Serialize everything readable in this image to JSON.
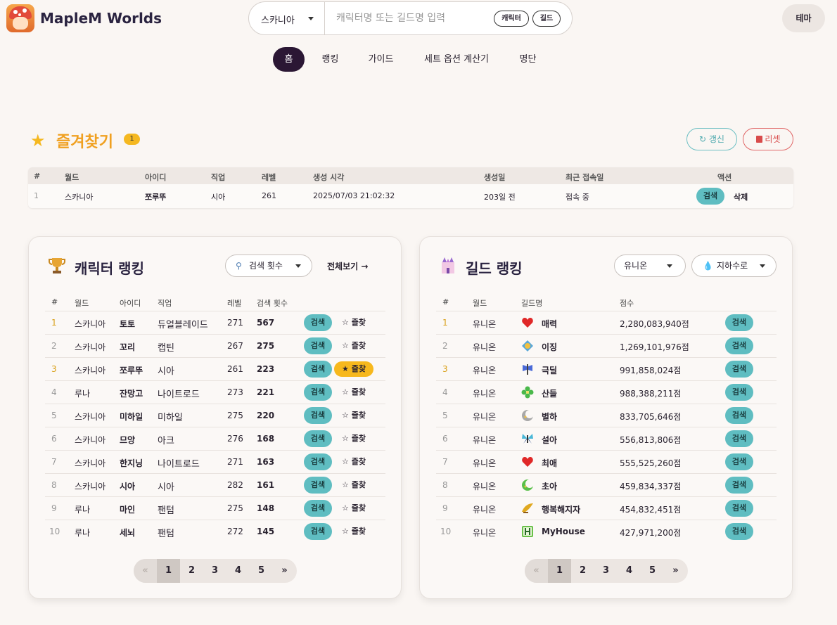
{
  "header": {
    "brand": "MapleM Worlds",
    "search": {
      "world": "스카니아",
      "placeholder": "캐릭터명 또는 길드명 입력",
      "chip_character": "캐릭터",
      "chip_guild": "길드"
    },
    "theme_label": "테마"
  },
  "nav": [
    "홈",
    "랭킹",
    "가이드",
    "세트 옵션 계산기",
    "명단"
  ],
  "favorites": {
    "title": "즐겨찾기",
    "count": "1",
    "refresh_label": "갱신",
    "reset_label": "리셋",
    "columns": [
      "#",
      "월드",
      "아이디",
      "직업",
      "레벨",
      "생성 시각",
      "생성일",
      "최근 접속일",
      "액션"
    ],
    "rows": [
      {
        "rank": "1",
        "world": "스카니아",
        "id": "쪼루뚜",
        "job": "시아",
        "level": "261",
        "created_at": "2025/07/03 21:02:32",
        "created_ago": "203일 전",
        "last_login": "접속 중",
        "search": "검색",
        "delete": "삭제"
      }
    ]
  },
  "char_ranking": {
    "title": "캐릭터 랭킹",
    "sort_label": "검색 횟수",
    "viewall": "전체보기 →",
    "columns": [
      "#",
      "월드",
      "아이디",
      "직업",
      "레벨",
      "검색 횟수"
    ],
    "search_label": "검색",
    "rows": [
      {
        "rank": "1",
        "world": "스카니아",
        "id": "토토",
        "job": "듀얼블레이드",
        "level": "271",
        "count": "567",
        "fav": "☆ 즐찾"
      },
      {
        "rank": "2",
        "world": "스카니아",
        "id": "꼬리",
        "job": "캡틴",
        "level": "267",
        "count": "275",
        "fav": "☆ 즐찾"
      },
      {
        "rank": "3",
        "world": "스카니아",
        "id": "쪼루뚜",
        "job": "시아",
        "level": "261",
        "count": "223",
        "fav": "★ 즐찾"
      },
      {
        "rank": "4",
        "world": "루나",
        "id": "잔망고",
        "job": "나이트로드",
        "level": "273",
        "count": "221",
        "fav": "☆ 즐찾"
      },
      {
        "rank": "5",
        "world": "스카니아",
        "id": "미하일",
        "job": "미하일",
        "level": "275",
        "count": "220",
        "fav": "☆ 즐찾"
      },
      {
        "rank": "6",
        "world": "스카니아",
        "id": "므앙",
        "job": "아크",
        "level": "276",
        "count": "168",
        "fav": "☆ 즐찾"
      },
      {
        "rank": "7",
        "world": "스카니아",
        "id": "한지닝",
        "job": "나이트로드",
        "level": "271",
        "count": "163",
        "fav": "☆ 즐찾"
      },
      {
        "rank": "8",
        "world": "스카니아",
        "id": "시아",
        "job": "시아",
        "level": "282",
        "count": "161",
        "fav": "☆ 즐찾"
      },
      {
        "rank": "9",
        "world": "루나",
        "id": "마인",
        "job": "팬텀",
        "level": "275",
        "count": "148",
        "fav": "☆ 즐찾"
      },
      {
        "rank": "10",
        "world": "루나",
        "id": "세뇌",
        "job": "팬텀",
        "level": "272",
        "count": "145",
        "fav": "☆ 즐찾"
      }
    ],
    "pager": [
      "«",
      "1",
      "2",
      "3",
      "4",
      "5",
      "»"
    ]
  },
  "guild_ranking": {
    "title": "길드 랭킹",
    "world_label": "유니온",
    "server_label": "지하수로",
    "columns": [
      "#",
      "월드",
      "길드명",
      "점수"
    ],
    "search_label": "검색",
    "rows": [
      {
        "rank": "1",
        "world": "유니온",
        "name": "매력",
        "score": "2,280,083,940점",
        "icon": "heart-icon"
      },
      {
        "rank": "2",
        "world": "유니온",
        "name": "이징",
        "score": "1,269,101,976점",
        "icon": "crest-icon"
      },
      {
        "rank": "3",
        "world": "유니온",
        "name": "극딜",
        "score": "991,858,024점",
        "icon": "axe-icon"
      },
      {
        "rank": "4",
        "world": "유니온",
        "name": "산들",
        "score": "988,388,211점",
        "icon": "clover-icon"
      },
      {
        "rank": "5",
        "world": "유니온",
        "name": "별하",
        "score": "833,705,646점",
        "icon": "moon-icon"
      },
      {
        "rank": "6",
        "world": "유니온",
        "name": "설아",
        "score": "556,813,806점",
        "icon": "butterfly-icon"
      },
      {
        "rank": "7",
        "world": "유니온",
        "name": "최애",
        "score": "555,525,260점",
        "icon": "heart-icon"
      },
      {
        "rank": "8",
        "world": "유니온",
        "name": "초아",
        "score": "459,834,337점",
        "icon": "moon-green-icon"
      },
      {
        "rank": "9",
        "world": "유니온",
        "name": "행복해지자",
        "score": "454,832,451점",
        "icon": "wing-icon"
      },
      {
        "rank": "10",
        "world": "유니온",
        "name": "MyHouse",
        "score": "427,971,200점",
        "icon": "house-h-icon"
      }
    ],
    "pager": [
      "«",
      "1",
      "2",
      "3",
      "4",
      "5",
      "»"
    ]
  }
}
